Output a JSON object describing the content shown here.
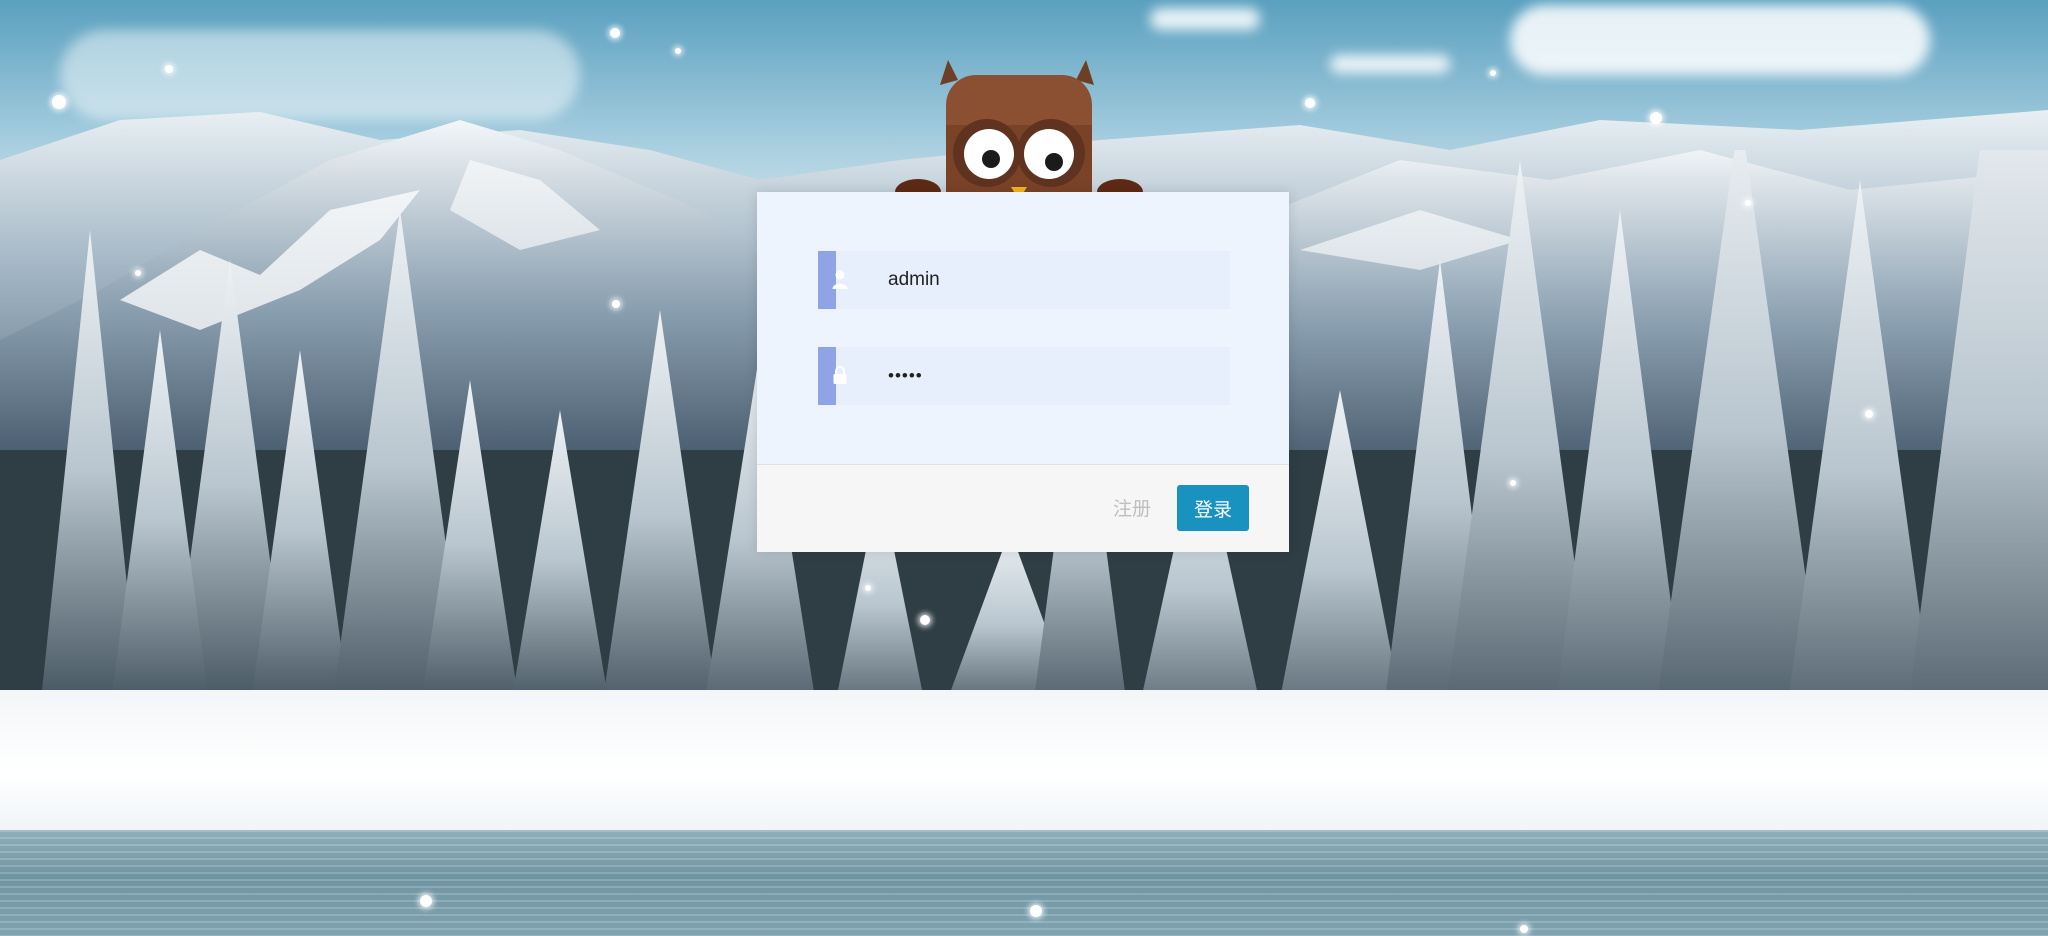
{
  "login": {
    "username_value": "admin",
    "password_value": "•••••",
    "register_label": "注册",
    "login_label": "登录"
  },
  "icons": {
    "user_field": "user-icon",
    "password_field": "lock-icon",
    "mascot": "owl-icon"
  },
  "colors": {
    "login_button": "#1a92c0",
    "field_accent": "#8fa4e4",
    "field_background": "#e7effd",
    "panel_background": "#eef4fd",
    "register_text": "#bfbfbf"
  }
}
